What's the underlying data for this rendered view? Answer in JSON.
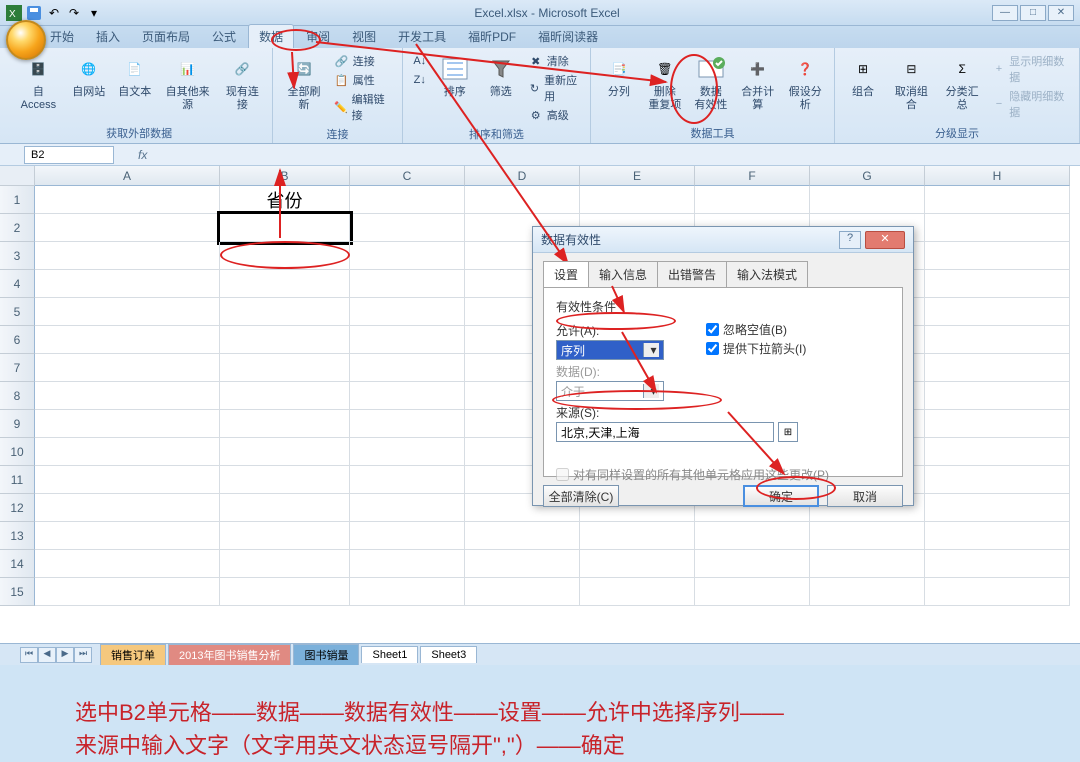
{
  "window": {
    "title": "Excel.xlsx - Microsoft Excel"
  },
  "menu": {
    "tabs": [
      "开始",
      "插入",
      "页面布局",
      "公式",
      "数据",
      "审阅",
      "视图",
      "开发工具",
      "福昕PDF",
      "福昕阅读器"
    ],
    "active_index": 4
  },
  "ribbon": {
    "g1": {
      "label": "获取外部数据",
      "b1": "自 Access",
      "b2": "自网站",
      "b3": "自文本",
      "b4": "自其他来源",
      "b5": "现有连接"
    },
    "g2": {
      "label": "连接",
      "b1": "全部刷新",
      "s1": "连接",
      "s2": "属性",
      "s3": "编辑链接"
    },
    "g3": {
      "label": "排序和筛选",
      "b1": "排序",
      "b2": "筛选",
      "s1": "清除",
      "s2": "重新应用",
      "s3": "高级"
    },
    "g4": {
      "label": "数据工具",
      "b1": "分列",
      "b2": "删除\n重复项",
      "b3": "数据\n有效性",
      "b4": "合并计算",
      "b5": "假设分析"
    },
    "g5": {
      "label": "分级显示",
      "b1": "组合",
      "b2": "取消组合",
      "b3": "分类汇总",
      "s1": "显示明细数据",
      "s2": "隐藏明细数据"
    }
  },
  "namebox": {
    "ref": "B2"
  },
  "cols": [
    "A",
    "B",
    "C",
    "D",
    "E",
    "F",
    "G",
    "H"
  ],
  "cells": {
    "B1": "省份"
  },
  "dialog": {
    "title": "数据有效性",
    "tabs": [
      "设置",
      "输入信息",
      "出错警告",
      "输入法模式"
    ],
    "legend": "有效性条件",
    "allow_label": "允许(A):",
    "allow_value": "序列",
    "data_label": "数据(D):",
    "data_value": "介于",
    "source_label": "来源(S):",
    "source_value": "北京,天津,上海",
    "chk_ignore": "忽略空值(B)",
    "chk_dropdown": "提供下拉箭头(I)",
    "chk_apply": "对有同样设置的所有其他单元格应用这些更改(P)",
    "btn_clear": "全部清除(C)",
    "btn_ok": "确定",
    "btn_cancel": "取消"
  },
  "annotation": {
    "line1": "选中B2单元格——数据——数据有效性——设置——允许中选择序列——",
    "line2": "来源中输入文字（文字用英文状态逗号隔开\",\"）——确定"
  },
  "sheets": {
    "s1": "销售订单",
    "s2": "2013年图书销售分析",
    "s3": "图书销量",
    "s4": "Sheet1",
    "s5": "Sheet3"
  }
}
